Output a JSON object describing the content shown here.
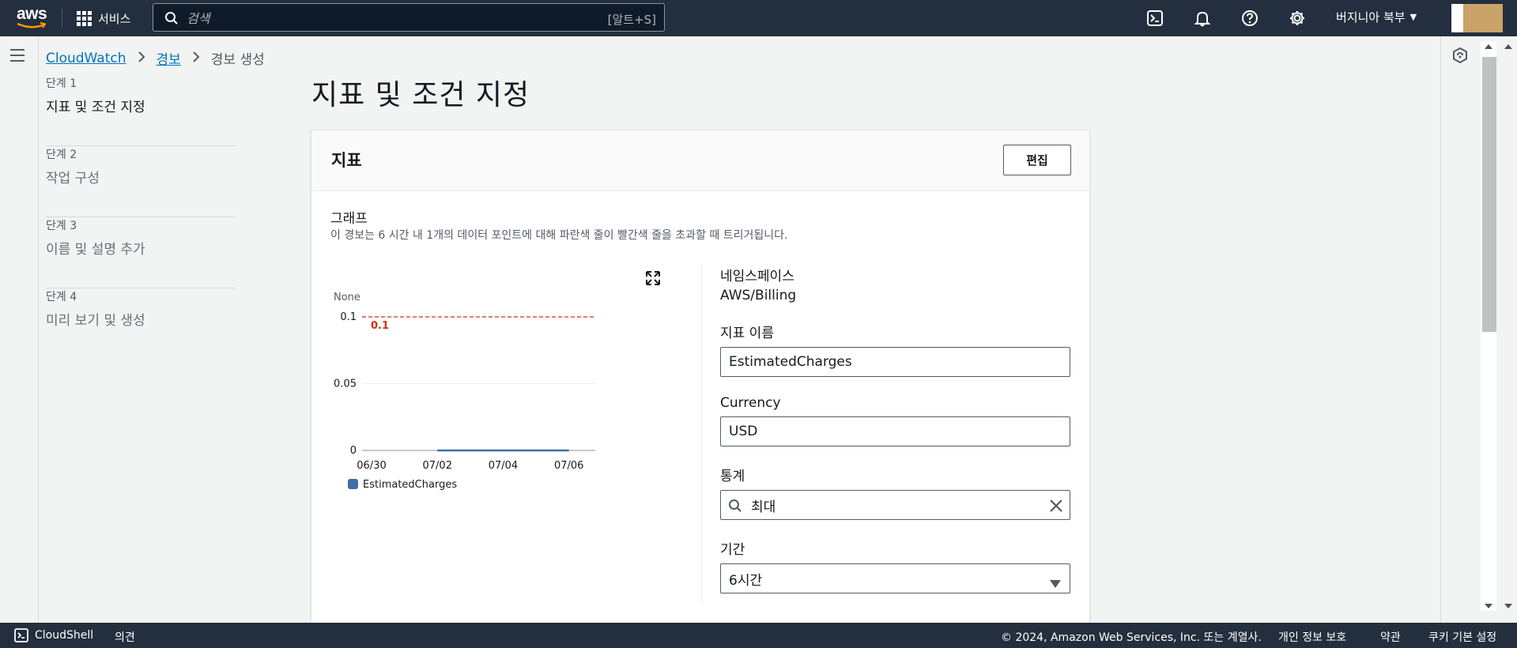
{
  "topnav": {
    "logo_text": "aws",
    "services_label": "서비스",
    "search_placeholder": "검색",
    "search_shortcut": "[알트+S]",
    "region_label": "버지니아 북부"
  },
  "breadcrumb": [
    {
      "label": "CloudWatch"
    },
    {
      "label": "경보"
    },
    {
      "label": "경보 생성"
    }
  ],
  "steps": [
    {
      "num": "단계 1",
      "label": "지표 및 조건 지정"
    },
    {
      "num": "단계 2",
      "label": "작업 구성"
    },
    {
      "num": "단계 3",
      "label": "이름 및 설명 추가"
    },
    {
      "num": "단계 4",
      "label": "미리 보기 및 생성"
    }
  ],
  "page_title": "지표 및 조건 지정",
  "panel": {
    "title": "지표",
    "edit_label": "편집",
    "graph_title": "그래프",
    "graph_desc": "이 경보는 6 시간 내 1개의 데이터 포인트에 대해 파란색 줄이 빨간색 줄을 초과할 때 트리거됩니다."
  },
  "chart_data": {
    "type": "line",
    "unit_label": "None",
    "ylim": [
      0,
      0.1
    ],
    "y_ticks": [
      "0.1",
      "0.05",
      "0"
    ],
    "x_ticks": [
      "06/30",
      "07/02",
      "07/04",
      "07/06"
    ],
    "threshold": {
      "value": 0.1,
      "label": "0.1",
      "color": "#d13212"
    },
    "series": [
      {
        "name": "EstimatedCharges",
        "color": "#3f6ea8",
        "x": [
          "07/02",
          "07/03",
          "07/04",
          "07/05",
          "07/06"
        ],
        "values": [
          0,
          0,
          0,
          0,
          0
        ]
      }
    ]
  },
  "form": {
    "namespace_label": "네임스페이스",
    "namespace_value": "AWS/Billing",
    "metric_name_label": "지표 이름",
    "metric_name_value": "EstimatedCharges",
    "currency_label": "Currency",
    "currency_value": "USD",
    "statistic_label": "통계",
    "statistic_value": "최대",
    "period_label": "기간",
    "period_value": "6시간"
  },
  "footer": {
    "cloudshell": "CloudShell",
    "feedback": "의견",
    "copyright": "© 2024, Amazon Web Services, Inc. 또는 계열사.",
    "privacy": "개인 정보 보호",
    "terms": "약관",
    "cookies": "쿠키 기본 설정"
  },
  "colors": {
    "nav_bg": "#232f3e",
    "link": "#0073bb",
    "threshold": "#d13212",
    "series": "#3f6ea8"
  }
}
